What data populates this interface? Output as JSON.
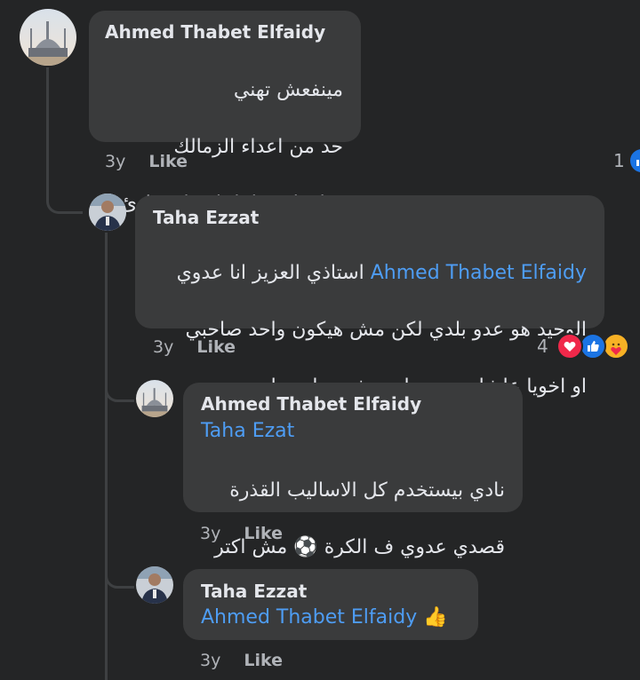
{
  "comments": [
    {
      "author": "Ahmed Thabet Elfaidy",
      "lines": [
        "مينفعش تهني",
        "حد من اعداء الزمالك",
        "دول نادي بلا اخلاق او مبادئ"
      ],
      "time": "3y",
      "like_label": "Like",
      "reaction_count": "1",
      "reactions": [
        "like-icon"
      ]
    },
    {
      "author": "Taha Ezzat",
      "mention": "Ahmed Thabet Elfaidy",
      "line1_rest": " استاذي العزيز انا عدوي",
      "lines": [
        "الوحيد هو عدو بلدي لكن مش هيكون واحد صاحبي",
        "او اخويا علشان مجرد انه بيشجع نادي تاني"
      ],
      "time": "3y",
      "like_label": "Like",
      "reaction_count": "4",
      "reactions": [
        "love-icon",
        "like-icon",
        "care-icon"
      ]
    },
    {
      "author": "Ahmed Thabet Elfaidy",
      "mention": "Taha Ezat",
      "lines": [
        "نادي بيستخدم كل الاساليب القذرة",
        "قصدي عدوي ف الكرة ⚽ مش اكتر"
      ],
      "time": "3y",
      "like_label": "Like"
    },
    {
      "author": "Taha Ezzat",
      "mention": "Ahmed Thabet Elfaidy",
      "emoji": "👍",
      "time": "3y",
      "like_label": "Like"
    }
  ],
  "colors": {
    "background": "#242526",
    "bubble": "#3a3b3c",
    "mention": "#4e9df4",
    "like_reaction": "#1b74e4",
    "love_reaction": "#f0284a"
  }
}
